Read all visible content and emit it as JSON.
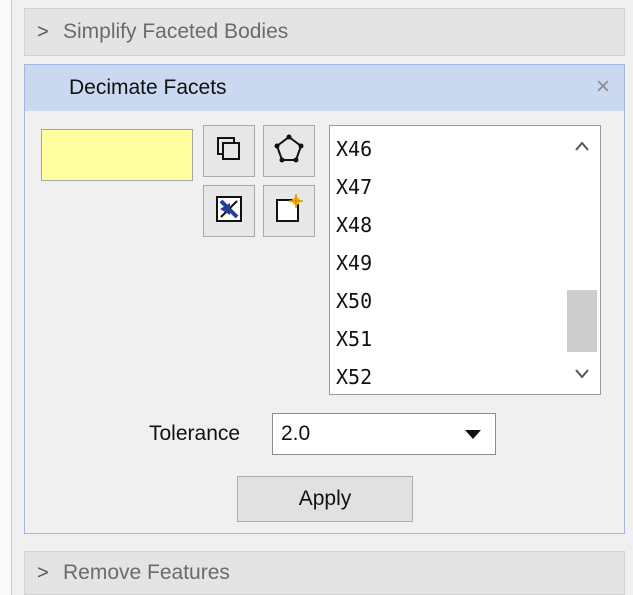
{
  "sections": {
    "simplify": {
      "chevron": ">",
      "title": "Simplify Faceted Bodies"
    },
    "decimate": {
      "title": "Decimate Facets",
      "close": "×"
    },
    "remove": {
      "chevron": ">",
      "title": "Remove Features"
    }
  },
  "selection": {
    "color": "#ffffa0"
  },
  "tools": [
    {
      "name": "copy-icon"
    },
    {
      "name": "polygon-points-icon"
    },
    {
      "name": "remove-x-icon"
    },
    {
      "name": "new-spark-icon"
    }
  ],
  "list": {
    "items": [
      "X46",
      "X47",
      "X48",
      "X49",
      "X50",
      "X51",
      "X52"
    ],
    "scroll_up": "^",
    "scroll_down": "v"
  },
  "tolerance": {
    "label": "Tolerance",
    "value": "2.0"
  },
  "apply": {
    "label": "Apply"
  },
  "colors": {
    "header_active": "#cad9ef",
    "panel_border": "#9fb8dd",
    "selection_fill": "#ffffa0"
  }
}
